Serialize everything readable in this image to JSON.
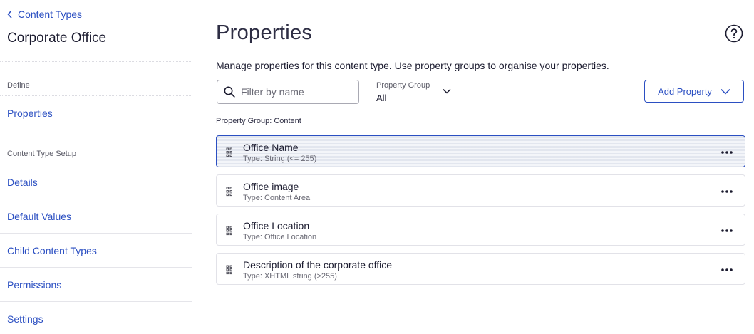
{
  "sidebar": {
    "back_label": "Content Types",
    "title": "Corporate Office",
    "section_define": "Define",
    "nav_properties": "Properties",
    "section_setup": "Content Type Setup",
    "nav_details": "Details",
    "nav_default_values": "Default Values",
    "nav_child_content_types": "Child Content Types",
    "nav_permissions": "Permissions",
    "nav_settings": "Settings"
  },
  "main": {
    "title": "Properties",
    "description": "Manage properties for this content type. Use property groups to organise your properties.",
    "search_placeholder": "Filter by name",
    "search_value": "",
    "group_filter": {
      "label": "Property Group",
      "value": "All"
    },
    "add_button_label": "Add Property",
    "group_heading": "Property Group: Content",
    "properties": [
      {
        "name": "Office Name",
        "type": "Type: String (<= 255)",
        "selected": true
      },
      {
        "name": "Office image",
        "type": "Type: Content Area",
        "selected": false
      },
      {
        "name": "Office Location",
        "type": "Type: Office Location",
        "selected": false
      },
      {
        "name": "Description of the corporate office",
        "type": "Type: XHTML string (>255)",
        "selected": false
      }
    ]
  },
  "colors": {
    "accent": "#2b4fc2",
    "text": "#1a1a2e",
    "muted": "#6a6a75",
    "border": "#e2e2e8",
    "selected_row_bg": "#f3f5f9"
  },
  "icons": {
    "back": "chevron-left-icon",
    "help": "help-circle-icon",
    "search": "search-icon",
    "dropdown": "chevron-down-icon",
    "drag": "drag-handle-icon",
    "more": "more-horizontal-icon"
  }
}
